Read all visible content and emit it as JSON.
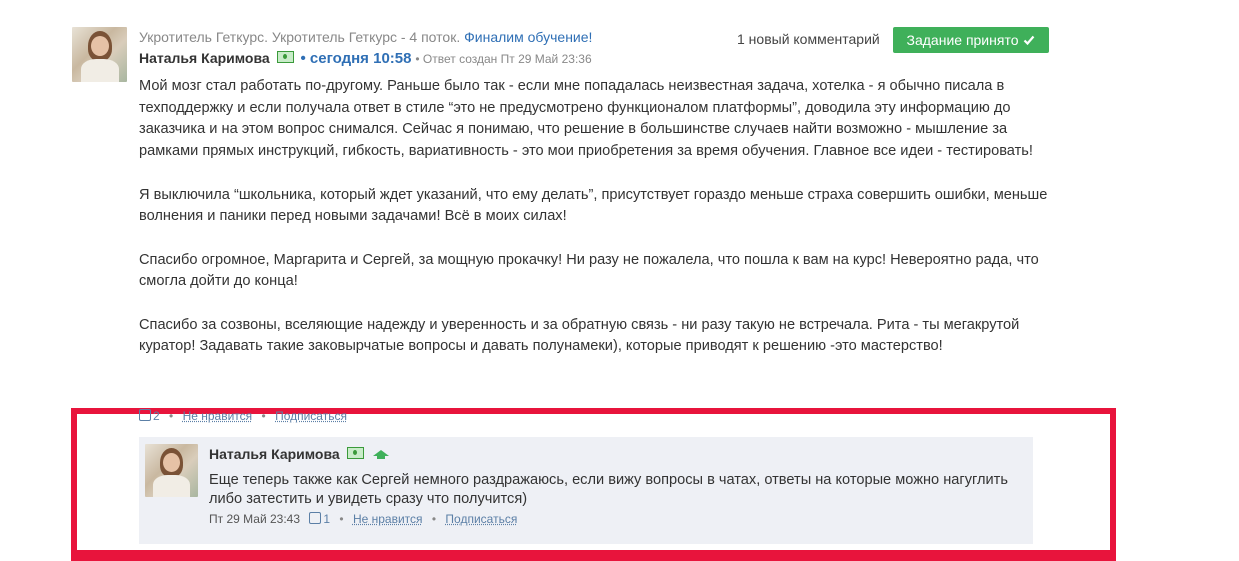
{
  "post": {
    "course": "Укротитель Геткурс. Укротитель Геткурс - 4 поток.",
    "lesson_link": "Финалим обучение!",
    "author": "Наталья Каримова",
    "time_link": "• сегодня 10:58",
    "created": "• Ответ создан Пт 29 Май 23:36",
    "new_comments": "1 новый комментарий",
    "accept_button": "Задание принято",
    "accept_icon": "check-icon",
    "paragraphs": [
      "Мой мозг стал работать по-другому. Раньше было так - если мне попадалась неизвестная задача, хотелка - я обычно писала в техподдержку и если получала ответ в стиле “это не предусмотрено функционалом платформы”, доводила эту информацию до заказчика и на этом вопрос снимался. Сейчас я понимаю, что решение в большинстве случаев найти возможно - мышление за рамками прямых инструкций, гибкость, вариативность - это мои приобретения за время обучения. Главное все идеи - тестировать!",
      "Я выключила “школьника, который ждет указаний, что ему делать”, присутствует гораздо меньше страха совершить ошибки, меньше волнения и паники перед новыми задачами! Всё в моих силах!",
      "Спасибо огромное, Маргарита и Сергей, за мощную прокачку! Ни разу не пожалела, что пошла к вам на курс! Невероятно рада, что смогла дойти до конца!",
      "Спасибо за созвоны, вселяющие надежду и уверенность и за обратную связь - ни разу такую не встречала. Рита - ты мегакрутой куратор! Задавать такие заковырчатые вопросы и давать полунамеки), которые приводят к решению -это мастерство!"
    ],
    "likes": "2",
    "dislike": "Не нравится",
    "subscribe": "Подписаться"
  },
  "reply": {
    "author": "Наталья Каримова",
    "text": "Еще теперь также как Сергей немного раздражаюсь, если вижу вопросы в чатах, ответы на которые можно нагуглить либо затестить и увидеть сразу что получится)",
    "date": "Пт 29 Май 23:43",
    "likes": "1",
    "dislike": "Не нравится",
    "subscribe": "Подписаться"
  },
  "colors": {
    "accent_link": "#2f6fb5",
    "accept_green": "#3fb05a",
    "highlight_red": "#e8143c"
  }
}
